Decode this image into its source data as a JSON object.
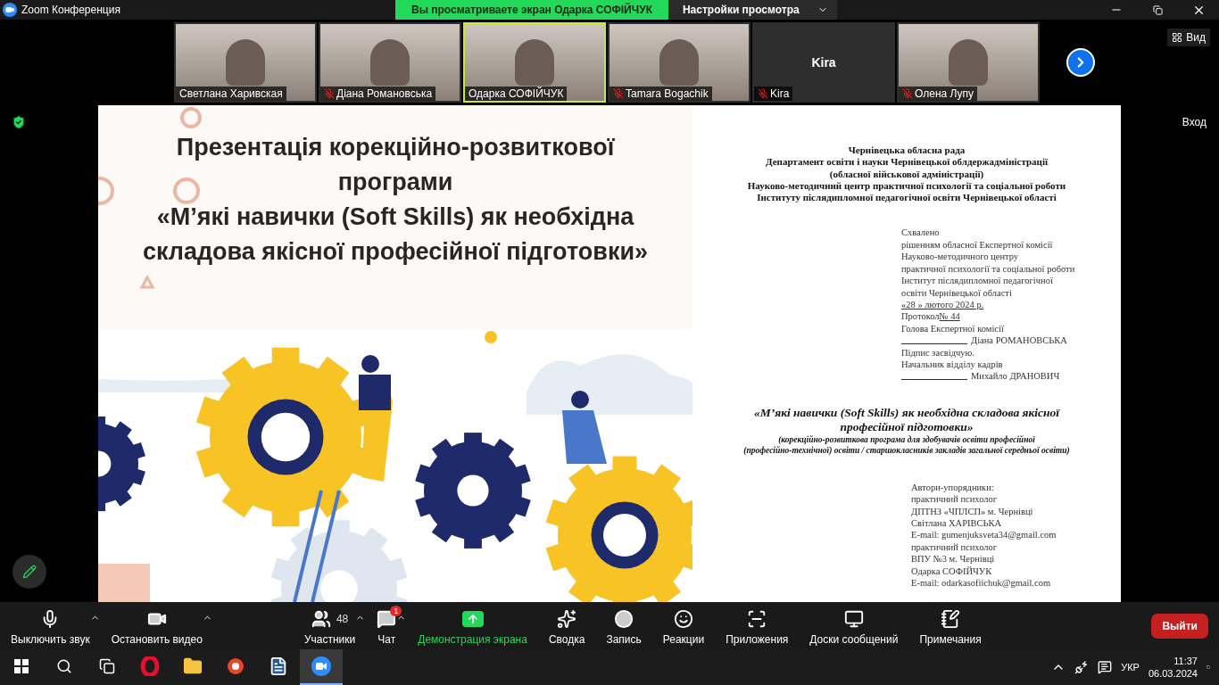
{
  "window": {
    "title": "Zoom Конференция"
  },
  "share_banner": {
    "message": "Вы просматриваете экран Одарка СОФІЙЧУК",
    "settings": "Настройки просмотра"
  },
  "gallery": {
    "view_button": "Вид",
    "participants": [
      {
        "name": "Светлана Харивская",
        "kind": "video",
        "muted": false,
        "speaking": false
      },
      {
        "name": "Діана Романовська",
        "kind": "video",
        "muted": true,
        "speaking": false
      },
      {
        "name": "Одарка СОФІЙЧУК",
        "kind": "video",
        "muted": false,
        "speaking": true
      },
      {
        "name": "Tamara Bogachik",
        "kind": "video",
        "muted": true,
        "speaking": false
      },
      {
        "name": "Kira",
        "kind": "name",
        "display": "Kira",
        "muted": true,
        "speaking": false
      },
      {
        "name": "Олена Лупу",
        "kind": "video",
        "muted": true,
        "speaking": false
      }
    ]
  },
  "right_rail": {
    "enter_label": "Вход"
  },
  "slide": {
    "title_lines": [
      "Презентація корекційно-розвиткової",
      "програми",
      "«М’які навички (Soft Skills) як необхідна",
      "складова якісної професійної підготовки»"
    ]
  },
  "document": {
    "header_lines": [
      "Чернівецька обласна рада",
      "Департамент освіти і науки Чернівецької облдержадміністрації",
      "(обласної військової адміністрації)",
      "Науково-методичний центр практичної психології та соціальної роботи",
      "Інституту післядипломної педагогічної освіти Чернівецької області"
    ],
    "approval": [
      {
        "kind": "text",
        "text": "Схвалено"
      },
      {
        "kind": "text",
        "text": "рішенням обласної Експертної комісії"
      },
      {
        "kind": "text",
        "text": "Науково-методичного центру"
      },
      {
        "kind": "text",
        "text": "практичної психології та соціальної роботи"
      },
      {
        "kind": "text",
        "text": "Інститут післядипломної педагогічної"
      },
      {
        "kind": "text",
        "text": "освіти Чернівецької області"
      },
      {
        "kind": "underlined",
        "text": "«28 » лютого  2024 р."
      },
      {
        "kind": "label_value",
        "text": "Протокол",
        "value": "№  44"
      },
      {
        "kind": "text",
        "text": "Голова Експертної комісії"
      },
      {
        "kind": "signature",
        "text": "Діана РОМАНОВСЬКА"
      },
      {
        "kind": "text",
        "text": "Підпис засвідчую."
      },
      {
        "kind": "text",
        "text": "Начальник відділу кадрів"
      },
      {
        "kind": "signature",
        "text": "Михайло ДРАНОВИЧ"
      }
    ],
    "title_lines": [
      "«М’які навички (Soft Skills) як необхідна складова якісної",
      "професійної підготовки»"
    ],
    "subtitle_lines": [
      "(корекційно-розвиткова програма для здобувачів освіти професійної",
      "(професійно-технічної) освіти / старшокласників закладів загальної середньої освіти)"
    ],
    "authors": [
      "Автори-упорядники:",
      "практичний психолог",
      "ДПТНЗ «ЧПЛСП» м. Чернівці",
      "Світлана ХАРІВСЬКА",
      "E-mail: gumenjuksveta34@gmail.com",
      "практичний психолог",
      "ВПУ №3 м. Чернівці",
      "Одарка СОФІЙЧУК",
      "E-mail: odarkasofiichuk@gmail.com"
    ]
  },
  "toolbar": {
    "items": [
      {
        "kind": "mic",
        "label": "Выключить звук",
        "has_menu": true,
        "active": false
      },
      {
        "kind": "video",
        "label": "Остановить видео",
        "has_menu": true,
        "active": false
      },
      {
        "kind": "participants",
        "label": "Участники",
        "count": "48",
        "has_menu": true,
        "active": false
      },
      {
        "kind": "chat",
        "label": "Чат",
        "badge": "1",
        "has_menu": true,
        "active": false
      },
      {
        "kind": "share",
        "label": "Демонстрация экрана",
        "has_menu": false,
        "active": true
      },
      {
        "kind": "summary",
        "label": "Сводка",
        "has_menu": false,
        "active": false
      },
      {
        "kind": "record",
        "label": "Запись",
        "has_menu": false,
        "active": false
      },
      {
        "kind": "reactions",
        "label": "Реакции",
        "has_menu": false,
        "active": false
      },
      {
        "kind": "apps",
        "label": "Приложения",
        "has_menu": false,
        "active": false
      },
      {
        "kind": "whiteboards",
        "label": "Доски сообщений",
        "has_menu": false,
        "active": false
      },
      {
        "kind": "notes",
        "label": "Примечания",
        "has_menu": false,
        "active": false
      }
    ],
    "leave": "Выйти"
  },
  "taskbar": {
    "apps": [
      {
        "kind": "browser",
        "selected": false
      },
      {
        "kind": "folder",
        "selected": false
      },
      {
        "kind": "app",
        "selected": false
      },
      {
        "kind": "word",
        "selected": false
      },
      {
        "kind": "zoom",
        "selected": true
      }
    ],
    "language": "УКР",
    "time": "11:37",
    "date": "06.03.2024"
  }
}
